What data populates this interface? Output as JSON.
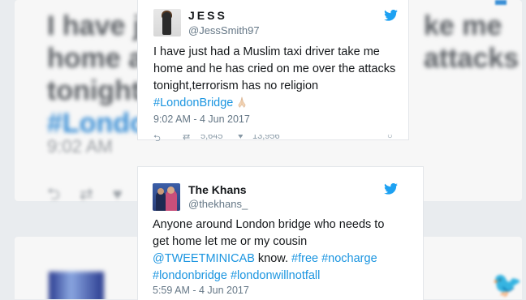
{
  "background": {
    "blur_left": [
      "I have ju",
      "home a",
      "tonight,",
      "#Londo"
    ],
    "blur_right": [
      "ke me",
      "attacks"
    ],
    "blur_time": "9:02 AM"
  },
  "tweets": [
    {
      "name": "JESS",
      "handle": "@JessSmith97",
      "text_lines": [
        "I have just had a Muslim taxi driver take me",
        "home and he has cried on me over the attacks",
        "tonight,terrorism has no religion"
      ],
      "hashtag": "#LondonBridge",
      "time": "9:02 AM - 4 Jun 2017",
      "retweets": "5,645",
      "likes": "13,956"
    },
    {
      "name": "The Khans",
      "handle": "@thekhans_",
      "text_lines": [
        "Anyone around London bridge who needs to",
        "get home let me or my cousin"
      ],
      "mention": "@TWEETMINICAB",
      "after_mention": " know. ",
      "tags_line1": "#free #nocharge",
      "tags_line2": "#londonbridge #londonwillnotfall",
      "time": "5:59 AM - 4 Jun 2017"
    }
  ],
  "colors": {
    "link": "#1b95e0",
    "twitter_blue": "#1da1f2",
    "secondary_text": "#657786"
  },
  "icons": [
    "twitter-bird-icon",
    "praying-hands-emoji",
    "reply-icon",
    "retweet-icon",
    "like-icon"
  ]
}
